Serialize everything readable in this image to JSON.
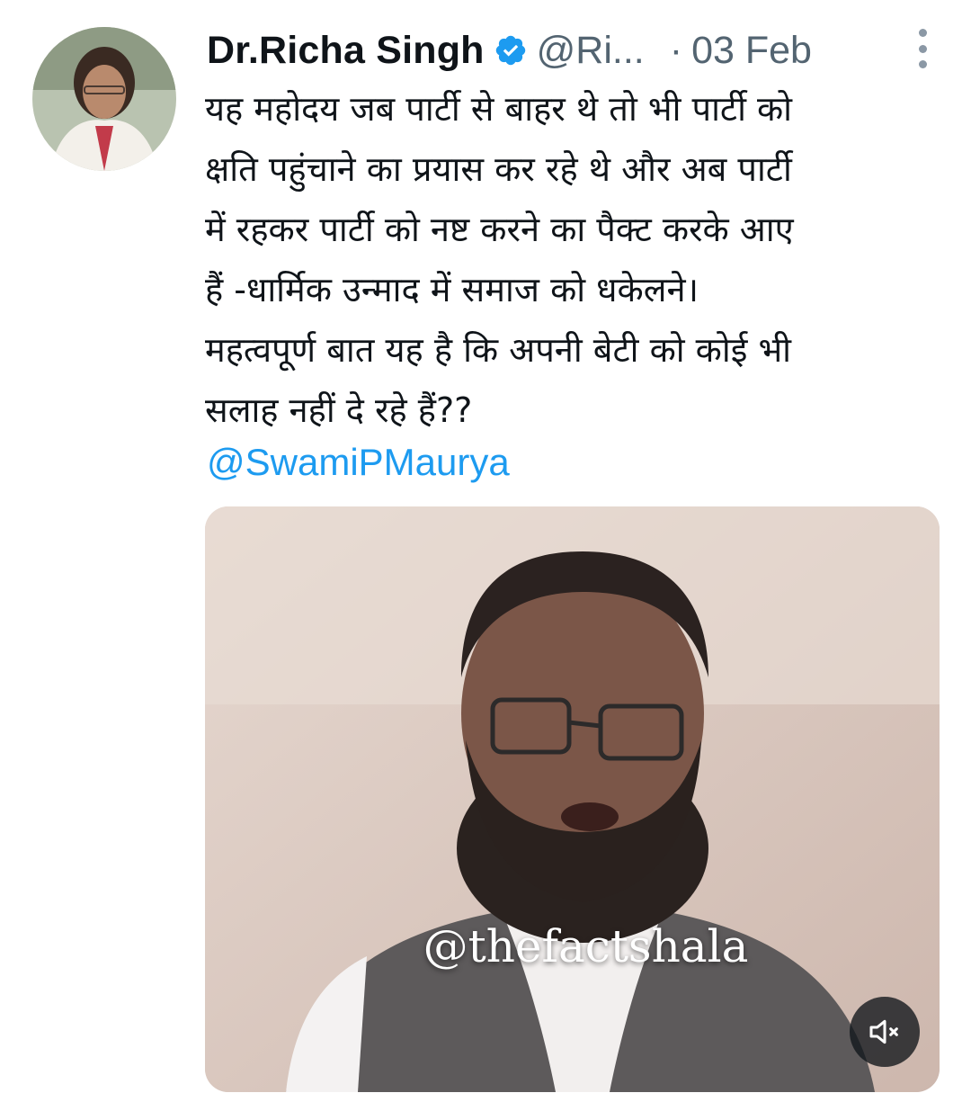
{
  "author": {
    "display_name": "Dr.Richa Singh",
    "handle": "@Ri...",
    "separator": "·",
    "date": "03 Feb",
    "verified": true
  },
  "tweet": {
    "lines": [
      "यह महोदय जब पार्टी से बाहर थे तो भी पार्टी को",
      "क्षति पहुंचाने का प्रयास कर रहे थे और अब पार्टी",
      "में रहकर पार्टी को नष्ट करने का पैक्ट करके आए",
      "हैं -धार्मिक उन्माद में समाज को धकेलने।",
      "महत्वपूर्ण बात यह है कि अपनी बेटी को कोई भी",
      "सलाह नहीं दे रहे हैं??"
    ],
    "mention": "@SwamiPMaurya"
  },
  "media": {
    "type": "video",
    "watermark": "@thefactshala",
    "muted": true,
    "mute_icon": "volume-mute-icon"
  },
  "icons": {
    "verified": "verified-badge-icon",
    "more": "more-vertical-icon"
  },
  "colors": {
    "text": "#0f1419",
    "secondary": "#536471",
    "link": "#1d9bf0",
    "verified": "#1d9bf0"
  }
}
